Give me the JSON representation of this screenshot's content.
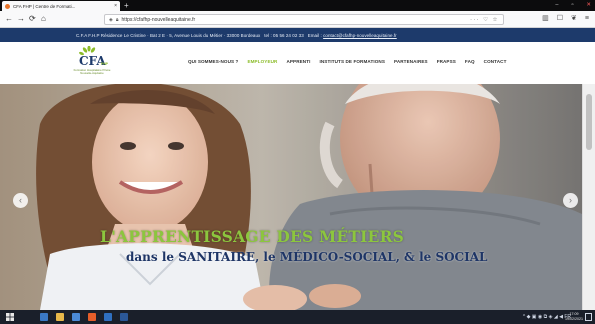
{
  "browser": {
    "tab_title": "CFA FHP | Centre de Formati...",
    "tab_close": "×",
    "new_tab": "+",
    "url": "https://cfafhp-nouvelleaquitaine.fr",
    "window_controls": {
      "minimize": "–",
      "maximize": "▫",
      "close": "✕"
    },
    "nav": {
      "back": "←",
      "forward": "→",
      "reload": "⟳",
      "home": "⌂"
    },
    "url_actions": "··· ♡ ☆",
    "toolbar_icons": [
      "▥",
      "☐",
      "❦",
      "≡"
    ]
  },
  "site": {
    "topbar": {
      "address": "C.F.A F.H.P  Résidence Le Cristine · Bat 2 E · 5, Avenue Louis du Métier · 33000 Bordeaux",
      "tel": "tel : 05 56 24 02 33",
      "email_label": "Email :",
      "email": "contact@cfafhp-nouvelleaquitaine.fr"
    },
    "logo": {
      "text": "CFA",
      "suffix": "FHP",
      "subtitle": "Formation Hospitalière Privée Nouvelle-Aquitaine"
    },
    "menu": [
      {
        "label": "QUI SOMMES-NOUS ?",
        "active": false
      },
      {
        "label": "EMPLOYEUR",
        "active": true
      },
      {
        "label": "APPRENTI",
        "active": false
      },
      {
        "label": "INSTITUTS DE FORMATIONS",
        "active": false
      },
      {
        "label": "PARTENAIRES",
        "active": false
      },
      {
        "label": "FRAPSS",
        "active": false
      },
      {
        "label": "FAQ",
        "active": false
      },
      {
        "label": "CONTACT",
        "active": false
      }
    ],
    "hero": {
      "title": "L'APPRENTISSAGE DES MÉTIERS",
      "subtitle": "dans le SANITAIRE, le MÉDICO-SOCIAL, & le SOCIAL",
      "prev": "‹",
      "next": "›"
    }
  },
  "taskbar": {
    "time": "17:09",
    "date": "19/02/2021",
    "tray_icons": "^ ◆ ▣ ◉ ⧉ ◈ ◢ ◀ FR"
  },
  "colors": {
    "site_primary": "#1d3a6b",
    "accent_green": "#8cbc2a",
    "taskbar": "#1a1f2a"
  }
}
